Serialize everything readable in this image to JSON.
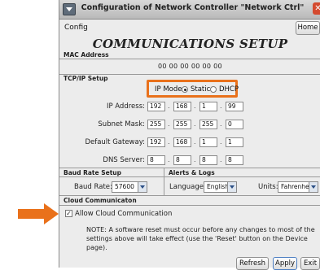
{
  "window": {
    "title": "Configuration of Network Controller \"Network Ctrl\"",
    "close_glyph": "✕"
  },
  "menubar": {
    "config": "Config",
    "home": "Home"
  },
  "heading": "COMMUNICATIONS SETUP",
  "mac": {
    "label": "MAC Address",
    "value": "00 00 00 00 00 00"
  },
  "tcpip": {
    "label": "TCP/IP Setup",
    "ip_mode_label": "IP Mode:",
    "static_label": "Static",
    "dhcp_label": "DHCP",
    "selected_mode": "Static",
    "highlight_color": "#e9711b",
    "ip_address": {
      "label": "IP Address:",
      "octets": [
        "192",
        "168",
        "1",
        "99"
      ]
    },
    "subnet_mask": {
      "label": "Subnet Mask:",
      "octets": [
        "255",
        "255",
        "255",
        "0"
      ]
    },
    "default_gateway": {
      "label": "Default Gateway:",
      "octets": [
        "192",
        "168",
        "1",
        "1"
      ]
    },
    "dns_server": {
      "label": "DNS Server:",
      "octets": [
        "8",
        "8",
        "8",
        "8"
      ]
    }
  },
  "baud": {
    "label": "Baud Rate Setup",
    "field_label": "Baud Rate:",
    "value": "57600"
  },
  "alerts": {
    "label": "Alerts & Logs",
    "language_label": "Language:",
    "language_value": "English",
    "units_label": "Units:",
    "units_value": "Fahrenheit"
  },
  "cloud": {
    "label": "Cloud Communicaton",
    "allow_label": "Allow Cloud Communication",
    "checked": true,
    "check_glyph": "✓",
    "arrow_color": "#e9711b"
  },
  "note": {
    "line1": "NOTE: A software reset must occur before any changes to most of the",
    "line2": "settings above will take effect (use the 'Reset' button on the Device page)."
  },
  "buttons": {
    "refresh": "Refresh",
    "apply": "Apply",
    "exit": "Exit"
  }
}
